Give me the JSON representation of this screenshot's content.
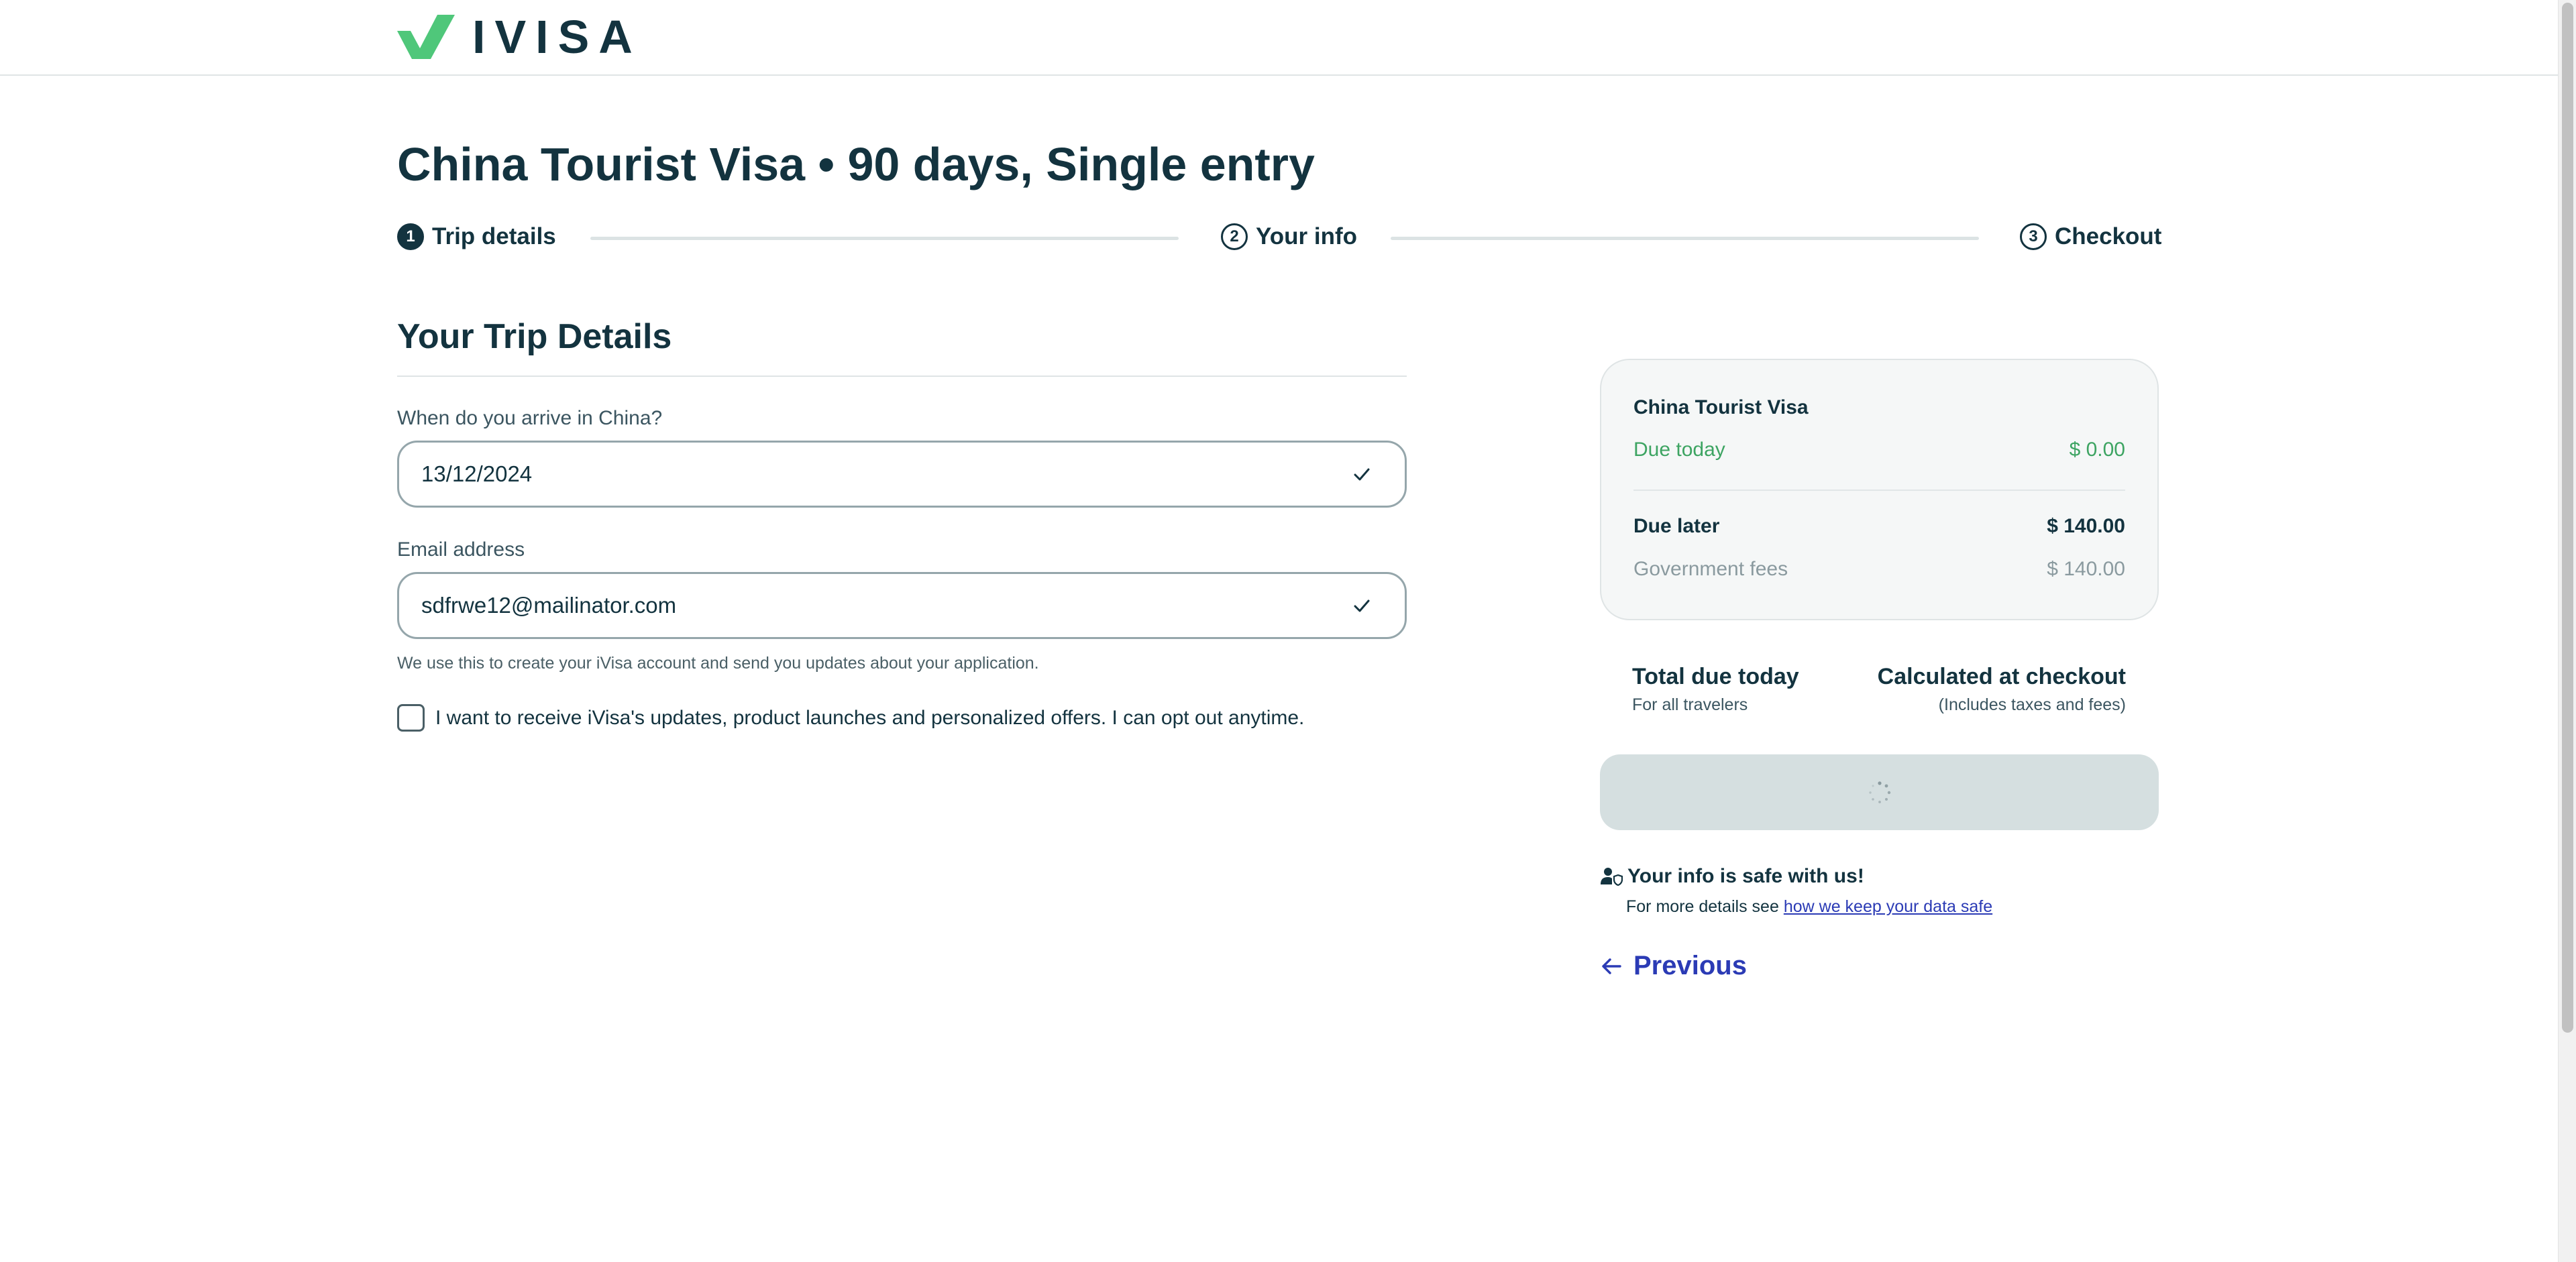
{
  "header": {
    "brand": "IVISA",
    "logo_icon": "ivisa-check-logo",
    "brand_color": "#4fc77a"
  },
  "page": {
    "title": "China Tourist Visa • 90 days, Single entry"
  },
  "stepper": [
    {
      "number": "1",
      "label": "Trip details",
      "active": true
    },
    {
      "number": "2",
      "label": "Your info",
      "active": false
    },
    {
      "number": "3",
      "label": "Checkout",
      "active": false
    }
  ],
  "form": {
    "section_title": "Your Trip Details",
    "arrival": {
      "label": "When do you arrive in China?",
      "value": "13/12/2024",
      "icon": "check-icon"
    },
    "email": {
      "label": "Email address",
      "value": "sdfrwe12@mailinator.com",
      "icon": "check-icon",
      "help": "We use this to create your iVisa account and send you updates about your application."
    },
    "optin": {
      "label": "I want to receive iVisa's updates, product launches and personalized offers. I can opt out anytime.",
      "checked": false
    }
  },
  "summary": {
    "title": "China Tourist Visa",
    "due_today_label": "Due today",
    "due_today_value": "$ 0.00",
    "due_later_label": "Due later",
    "due_later_value": "$ 140.00",
    "gov_fees_label": "Government fees",
    "gov_fees_value": "$ 140.00",
    "total_label": "Total due today",
    "total_sub": "For all travelers",
    "calc_label": "Calculated at checkout",
    "calc_sub": "(Includes taxes and fees)",
    "continue_icon": "spinner-icon"
  },
  "safety": {
    "icon": "user-shield-icon",
    "title": "Your info is safe with us!",
    "text": "For more details see ",
    "link": "how we keep your data safe"
  },
  "nav": {
    "previous_label": "Previous",
    "previous_icon": "arrow-left-icon"
  },
  "colors": {
    "primary_text": "#13333f",
    "green": "#3da462",
    "link": "#2b3bb5",
    "button_disabled": "#d5dfe0"
  }
}
